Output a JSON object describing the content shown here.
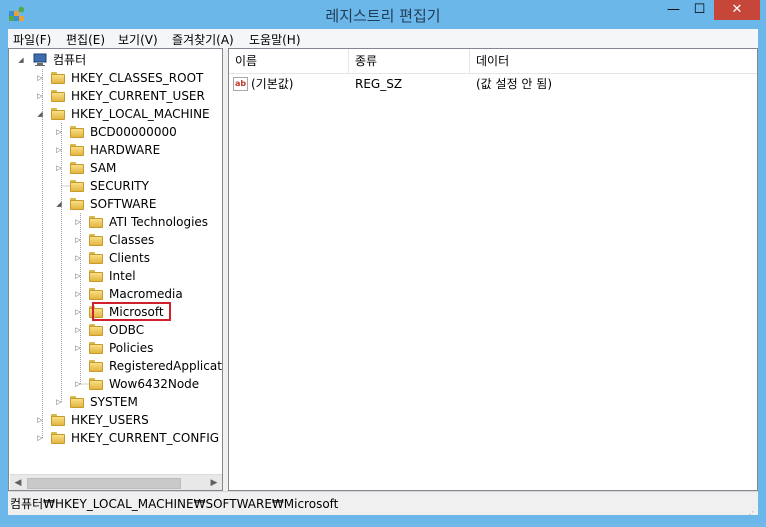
{
  "window": {
    "title": "레지스트리 편집기",
    "controls": {
      "minimize": "—",
      "maximize": "☐",
      "close": "✕"
    }
  },
  "menu": [
    "파일(F)",
    "편집(E)",
    "보기(V)",
    "즐겨찾기(A)",
    "도움말(H)"
  ],
  "tree": {
    "root": "컴퓨터",
    "nodes": [
      "HKEY_CLASSES_ROOT",
      "HKEY_CURRENT_USER",
      "HKEY_LOCAL_MACHINE",
      "BCD00000000",
      "HARDWARE",
      "SAM",
      "SECURITY",
      "SOFTWARE",
      "ATI Technologies",
      "Classes",
      "Clients",
      "Intel",
      "Macromedia",
      "Microsoft",
      "ODBC",
      "Policies",
      "RegisteredApplication",
      "Wow6432Node",
      "SYSTEM",
      "HKEY_USERS",
      "HKEY_CURRENT_CONFIG"
    ],
    "selected": "Microsoft",
    "scroll_left": "◀",
    "scroll_right": "▶"
  },
  "list": {
    "columns": [
      "이름",
      "종류",
      "데이터"
    ],
    "rows": [
      {
        "name": "(기본값)",
        "type": "REG_SZ",
        "data": "(값 설정 안 됨)",
        "icon": "ab"
      }
    ]
  },
  "status": {
    "path": "컴퓨터₩HKEY_LOCAL_MACHINE₩SOFTWARE₩Microsoft"
  },
  "colors": {
    "titlebar": "#6cb7ea",
    "close_button": "#c7463a",
    "selection_outline": "#d0202b"
  }
}
